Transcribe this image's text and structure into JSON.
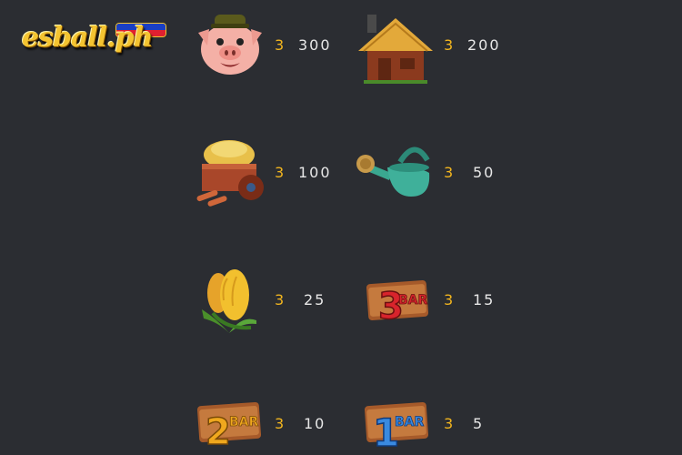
{
  "brand": {
    "logo_text": "esball.ph"
  },
  "paytable": [
    {
      "symbol": "pig-icon",
      "count": "3",
      "payout": "300"
    },
    {
      "symbol": "barn-icon",
      "count": "3",
      "payout": "200"
    },
    {
      "symbol": "hay-cart-icon",
      "count": "3",
      "payout": "100"
    },
    {
      "symbol": "watering-can-icon",
      "count": "3",
      "payout": "50"
    },
    {
      "symbol": "corn-icon",
      "count": "3",
      "payout": "25"
    },
    {
      "symbol": "3bar-icon",
      "count": "3",
      "payout": "15",
      "label": "3BAR"
    },
    {
      "symbol": "2bar-icon",
      "count": "3",
      "payout": "10",
      "label": "2BAR"
    },
    {
      "symbol": "1bar-icon",
      "count": "3",
      "payout": "5",
      "label": "1BAR"
    }
  ]
}
